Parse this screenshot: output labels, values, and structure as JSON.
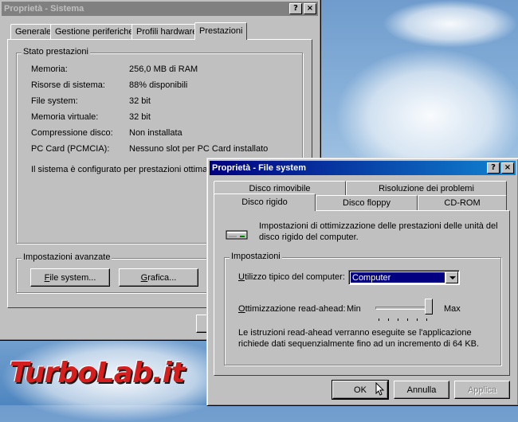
{
  "system_window": {
    "title": "Proprietà - Sistema",
    "help_btn": "?",
    "close_btn": "×",
    "tabs": [
      "Generale",
      "Gestione periferiche",
      "Profili hardware",
      "Prestazioni"
    ],
    "status_group": "Stato prestazioni",
    "rows": [
      {
        "label": "Memoria:",
        "value": "256,0 MB di RAM"
      },
      {
        "label": "Risorse di sistema:",
        "value": "88% disponibili"
      },
      {
        "label": "File system:",
        "value": "32 bit"
      },
      {
        "label": "Memoria virtuale:",
        "value": "32 bit"
      },
      {
        "label": "Compressione disco:",
        "value": "Non installata"
      },
      {
        "label": "PC Card (PCMCIA):",
        "value": "Nessuno slot per PC Card installato"
      }
    ],
    "message": "Il sistema è configurato per prestazioni ottimali.",
    "advanced_group": "Impostazioni avanzate",
    "btn_filesystem": {
      "u": "F",
      "rest": "ile system..."
    },
    "btn_grafica": {
      "u": "G",
      "rest": "rafica..."
    }
  },
  "fs_window": {
    "title": "Proprietà - File system",
    "help_btn": "?",
    "close_btn": "×",
    "tabs_back": [
      "Disco rimovibile",
      "Risoluzione dei problemi"
    ],
    "tabs_front": [
      "Disco rigido",
      "Disco floppy",
      "CD-ROM"
    ],
    "description": "Impostazioni di ottimizzazione delle prestazioni delle unità del disco rigido del computer.",
    "settings_group": "Impostazioni",
    "usage_label": {
      "u": "U",
      "rest": "tilizzo tipico del computer:"
    },
    "usage_value": "Computer",
    "readahead_label": {
      "u": "O",
      "rest": "ttimizzazione read-ahead:"
    },
    "slider_min": "Min",
    "slider_max": "Max",
    "slider_level": 1.0,
    "note": "Le istruzioni read-ahead verranno eseguite se l'applicazione richiede dati sequenzialmente fino ad un incremento di 64 KB.",
    "btn_ok": "OK",
    "btn_cancel": "Annulla",
    "btn_apply": "Applica"
  },
  "watermark": "TurboLab.it"
}
